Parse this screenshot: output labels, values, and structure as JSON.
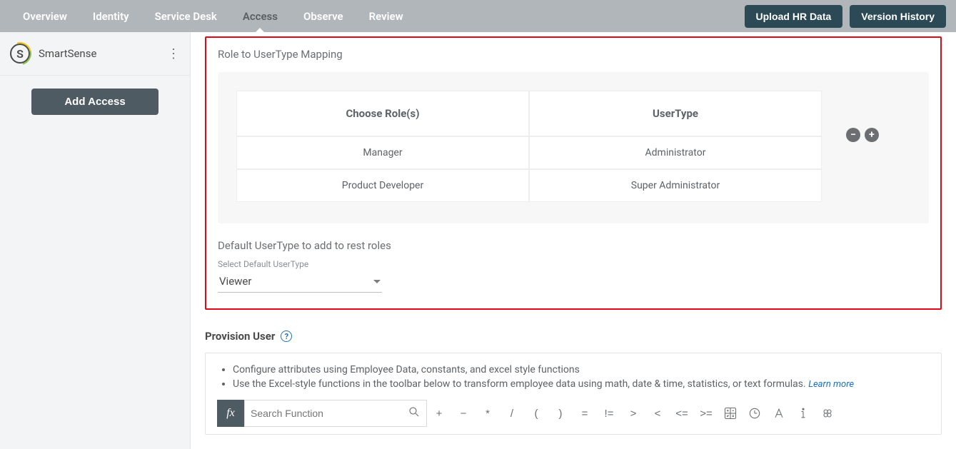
{
  "topbar": {
    "tabs": [
      "Overview",
      "Identity",
      "Service Desk",
      "Access",
      "Observe",
      "Review"
    ],
    "active_index": 3,
    "upload_label": "Upload HR Data",
    "version_label": "Version History"
  },
  "sidebar": {
    "app_initial": "S",
    "app_name": "SmartSense",
    "add_access_label": "Add Access"
  },
  "mapping": {
    "section_title": "Role to UserType Mapping",
    "headers": {
      "role": "Choose Role(s)",
      "usertype": "UserType"
    },
    "rows": [
      {
        "role": "Manager",
        "usertype": "Administrator"
      },
      {
        "role": "Product Developer",
        "usertype": "Super Administrator"
      }
    ]
  },
  "default_usertype": {
    "title": "Default UserType to add to rest roles",
    "field_label": "Select Default UserType",
    "value": "Viewer"
  },
  "provision": {
    "title": "Provision User",
    "bullets": [
      "Configure attributes using Employee Data, constants, and excel style functions",
      "Use the Excel-style functions in the toolbar below to transform employee data using math, date & time, statistics, or text formulas."
    ],
    "learn_more": "Learn more",
    "search_placeholder": "Search Function",
    "fx_label": "fx",
    "operators": [
      "+",
      "−",
      "*",
      "/",
      "(",
      ")",
      "=",
      "!=",
      ">",
      "<",
      "<=",
      ">="
    ]
  }
}
